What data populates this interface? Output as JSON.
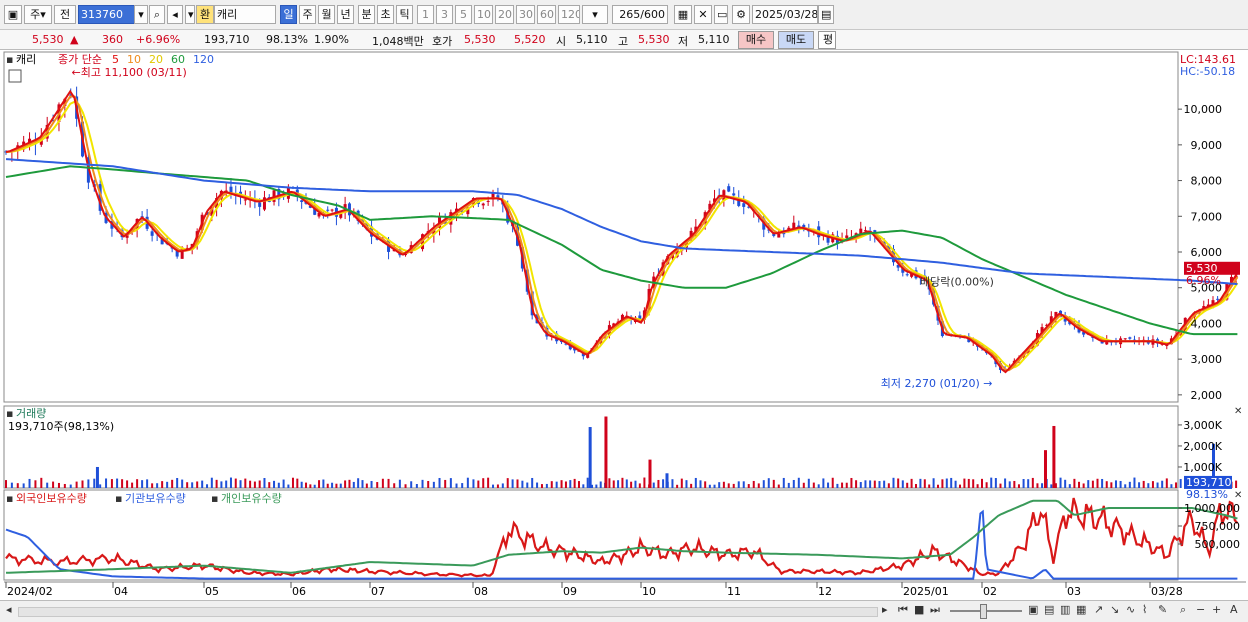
{
  "toolbar": {
    "mode": "주",
    "market": "전",
    "code": "313760",
    "stock_badge": "환",
    "stock_name": "캐리",
    "periods": [
      "일",
      "주",
      "월",
      "년",
      "분",
      "초",
      "틱"
    ],
    "intervals": [
      "1",
      "3",
      "5",
      "10",
      "20",
      "30",
      "60",
      "120"
    ],
    "count": "265",
    "count_max": "/600",
    "date": "2025/03/28"
  },
  "quote": {
    "price": "5,530",
    "change": "360",
    "change_pct": "+6.96%",
    "volume": "193,710",
    "vol_ratio": "98.13%",
    "turnover": "1.90%",
    "amount": "1,048백만",
    "ask_label": "호가",
    "ask1": "5,530",
    "ask2": "5,520",
    "open_label": "시",
    "open": "5,110",
    "high_label": "고",
    "high": "5,530",
    "low_label": "저",
    "low": "5,110",
    "buy": "매수",
    "sell": "매도",
    "eval": "평"
  },
  "panels": {
    "price_title": "캐리",
    "ma_title": "종가 단순",
    "vol_title": "거래량",
    "vol_info": "193,710주(98,13%)",
    "lc": "LC:143.61",
    "hc": "HC:-50.18"
  },
  "colors": {
    "up": "#d0021b",
    "down": "#1e4fd8",
    "ma5": "#e01010",
    "ma10": "#f08c1e",
    "ma20": "#f2e600",
    "ma60": "#1e9a3c",
    "ma120": "#2f5fe0",
    "foreign": "#d81818",
    "institution": "#2f5fe0",
    "individual": "#3a9a5a"
  },
  "chart_data": [
    {
      "type": "candlestick",
      "title": "캐리",
      "ylim": [
        1800,
        11600
      ],
      "y_ticks": [
        "10,000",
        "9,000",
        "8,000",
        "7,000",
        "6,000",
        "5,000",
        "4,000",
        "3,000",
        "2,000"
      ],
      "x_ticks": [
        "2024/02",
        "04",
        "05",
        "06",
        "07",
        "08",
        "09",
        "10",
        "11",
        "12",
        "2025/01",
        "02",
        "03",
        "03/28"
      ],
      "close_points": [
        {
          "m": 0,
          "v": 8800
        },
        {
          "m": 0.3,
          "v": 9200
        },
        {
          "m": 0.6,
          "v": 10600
        },
        {
          "m": 0.75,
          "v": 8300
        },
        {
          "m": 0.9,
          "v": 7000
        },
        {
          "m": 1.1,
          "v": 6400
        },
        {
          "m": 1.3,
          "v": 7000
        },
        {
          "m": 1.5,
          "v": 6400
        },
        {
          "m": 1.7,
          "v": 6000
        },
        {
          "m": 1.85,
          "v": 6100
        },
        {
          "m": 2.0,
          "v": 7100
        },
        {
          "m": 2.2,
          "v": 7700
        },
        {
          "m": 2.6,
          "v": 7400
        },
        {
          "m": 3.0,
          "v": 7700
        },
        {
          "m": 3.4,
          "v": 7000
        },
        {
          "m": 3.7,
          "v": 7200
        },
        {
          "m": 4.0,
          "v": 6500
        },
        {
          "m": 4.3,
          "v": 5900
        },
        {
          "m": 4.6,
          "v": 6700
        },
        {
          "m": 5.0,
          "v": 7500
        },
        {
          "m": 5.3,
          "v": 7500
        },
        {
          "m": 5.5,
          "v": 6300
        },
        {
          "m": 5.65,
          "v": 4300
        },
        {
          "m": 5.8,
          "v": 3700
        },
        {
          "m": 6.0,
          "v": 3500
        },
        {
          "m": 6.3,
          "v": 3100
        },
        {
          "m": 6.5,
          "v": 3700
        },
        {
          "m": 6.8,
          "v": 4200
        },
        {
          "m": 7.0,
          "v": 4000
        },
        {
          "m": 7.1,
          "v": 5000
        },
        {
          "m": 7.3,
          "v": 5900
        },
        {
          "m": 7.6,
          "v": 6500
        },
        {
          "m": 7.9,
          "v": 7600
        },
        {
          "m": 8.2,
          "v": 7400
        },
        {
          "m": 8.5,
          "v": 6500
        },
        {
          "m": 8.8,
          "v": 6700
        },
        {
          "m": 9.0,
          "v": 6500
        },
        {
          "m": 9.3,
          "v": 6300
        },
        {
          "m": 9.6,
          "v": 6600
        },
        {
          "m": 10.0,
          "v": 5500
        },
        {
          "m": 10.3,
          "v": 5200
        },
        {
          "m": 10.5,
          "v": 3700
        },
        {
          "m": 10.8,
          "v": 3600
        },
        {
          "m": 11.1,
          "v": 3100
        },
        {
          "m": 11.25,
          "v": 2600
        },
        {
          "m": 11.4,
          "v": 3000
        },
        {
          "m": 11.6,
          "v": 3500
        },
        {
          "m": 11.9,
          "v": 4300
        },
        {
          "m": 12.1,
          "v": 3900
        },
        {
          "m": 12.4,
          "v": 3500
        },
        {
          "m": 12.7,
          "v": 3500
        },
        {
          "m": 13.0,
          "v": 3500
        },
        {
          "m": 13.2,
          "v": 3400
        },
        {
          "m": 13.5,
          "v": 4300
        },
        {
          "m": 13.8,
          "v": 4600
        },
        {
          "m": 14.05,
          "v": 5530
        }
      ],
      "ma_legend": [
        {
          "name": "5",
          "color": "#e01010"
        },
        {
          "name": "10",
          "color": "#f08c1e"
        },
        {
          "name": "20",
          "color": "#e0c800"
        },
        {
          "name": "60",
          "color": "#1e9a3c"
        },
        {
          "name": "120",
          "color": "#2f5fe0"
        }
      ],
      "ma60_points": [
        {
          "m": 0,
          "v": 8100
        },
        {
          "m": 0.6,
          "v": 8400
        },
        {
          "m": 1.5,
          "v": 8200
        },
        {
          "m": 2.5,
          "v": 8000
        },
        {
          "m": 3.0,
          "v": 7600
        },
        {
          "m": 3.6,
          "v": 7300
        },
        {
          "m": 4.0,
          "v": 6900
        },
        {
          "m": 4.6,
          "v": 7000
        },
        {
          "m": 5.4,
          "v": 6900
        },
        {
          "m": 6.0,
          "v": 6200
        },
        {
          "m": 6.5,
          "v": 5500
        },
        {
          "m": 7.0,
          "v": 5200
        },
        {
          "m": 7.5,
          "v": 5000
        },
        {
          "m": 8.0,
          "v": 5000
        },
        {
          "m": 8.5,
          "v": 5400
        },
        {
          "m": 9.0,
          "v": 6000
        },
        {
          "m": 9.5,
          "v": 6500
        },
        {
          "m": 10.0,
          "v": 6600
        },
        {
          "m": 10.5,
          "v": 6400
        },
        {
          "m": 11.0,
          "v": 5800
        },
        {
          "m": 11.6,
          "v": 5200
        },
        {
          "m": 12.0,
          "v": 4800
        },
        {
          "m": 12.5,
          "v": 4400
        },
        {
          "m": 13.0,
          "v": 4000
        },
        {
          "m": 13.5,
          "v": 3700
        },
        {
          "m": 14.05,
          "v": 3700
        }
      ],
      "ma120_points": [
        {
          "m": 0,
          "v": 8600
        },
        {
          "m": 1.0,
          "v": 8400
        },
        {
          "m": 2.0,
          "v": 8000
        },
        {
          "m": 3.0,
          "v": 7800
        },
        {
          "m": 4.0,
          "v": 7700
        },
        {
          "m": 5.0,
          "v": 7700
        },
        {
          "m": 5.5,
          "v": 7600
        },
        {
          "m": 6.0,
          "v": 7200
        },
        {
          "m": 6.5,
          "v": 6700
        },
        {
          "m": 7.0,
          "v": 6300
        },
        {
          "m": 7.5,
          "v": 6100
        },
        {
          "m": 8.5,
          "v": 6000
        },
        {
          "m": 9.5,
          "v": 5900
        },
        {
          "m": 10.5,
          "v": 5700
        },
        {
          "m": 11.5,
          "v": 5400
        },
        {
          "m": 12.5,
          "v": 5300
        },
        {
          "m": 13.5,
          "v": 5200
        },
        {
          "m": 14.05,
          "v": 5100
        }
      ],
      "annotations": [
        {
          "text": "최고 11,100 (03/11)",
          "m": 0.65,
          "v": 11100
        },
        {
          "text": "최저 2,270 (01/20)",
          "m": 11.2,
          "v": 2270
        },
        {
          "text": "배당락(0.00%)",
          "m": 10.4,
          "v": 5000
        }
      ],
      "last_price": {
        "label": "5,530",
        "pct": "6.96%",
        "v": 5530
      }
    },
    {
      "type": "bar",
      "title": "거래량",
      "ylim": [
        0,
        3900000
      ],
      "y_ticks": [
        "3,000K",
        "2,000K",
        "1,000K"
      ],
      "y_tick_values": [
        3000000,
        2000000,
        1000000
      ],
      "spikes": [
        {
          "m": 0.85,
          "v": 1000000,
          "dir": "down"
        },
        {
          "m": 6.35,
          "v": 2900000,
          "dir": "down"
        },
        {
          "m": 6.55,
          "v": 3400000,
          "dir": "up"
        },
        {
          "m": 7.1,
          "v": 1350000,
          "dir": "up"
        },
        {
          "m": 7.3,
          "v": 700000,
          "dir": "down"
        },
        {
          "m": 11.85,
          "v": 2950000,
          "dir": "up"
        },
        {
          "m": 11.75,
          "v": 1800000,
          "dir": "up"
        },
        {
          "m": 13.75,
          "v": 2100000,
          "dir": "down"
        }
      ],
      "last": {
        "label": "193,710",
        "pct": "98.13%",
        "v": 193710
      }
    },
    {
      "type": "line",
      "ylim": [
        0,
        1250000
      ],
      "y_ticks": [
        "1,000,000",
        "750,000",
        "500,000"
      ],
      "y_tick_values": [
        1000000,
        750000,
        500000
      ],
      "series": [
        {
          "name": "외국인보유수량",
          "color": "#d81818",
          "points": [
            {
              "m": 0,
              "v": 300000
            },
            {
              "m": 0.5,
              "v": 250000
            },
            {
              "m": 1.0,
              "v": 300000
            },
            {
              "m": 1.5,
              "v": 150000
            },
            {
              "m": 2.0,
              "v": 200000
            },
            {
              "m": 2.5,
              "v": 100000
            },
            {
              "m": 3.0,
              "v": 80000
            },
            {
              "m": 3.5,
              "v": 150000
            },
            {
              "m": 4.0,
              "v": 120000
            },
            {
              "m": 4.6,
              "v": 80000
            },
            {
              "m": 5.2,
              "v": 60000
            },
            {
              "m": 5.4,
              "v": 700000
            },
            {
              "m": 5.8,
              "v": 450000
            },
            {
              "m": 6.2,
              "v": 350000
            },
            {
              "m": 6.5,
              "v": 250000
            },
            {
              "m": 6.8,
              "v": 350000
            },
            {
              "m": 7.0,
              "v": 450000
            },
            {
              "m": 7.3,
              "v": 350000
            },
            {
              "m": 7.6,
              "v": 450000
            },
            {
              "m": 8.0,
              "v": 350000
            },
            {
              "m": 8.3,
              "v": 400000
            },
            {
              "m": 8.6,
              "v": 120000
            },
            {
              "m": 9.0,
              "v": 120000
            },
            {
              "m": 9.5,
              "v": 100000
            },
            {
              "m": 10.0,
              "v": 200000
            },
            {
              "m": 10.4,
              "v": 400000
            },
            {
              "m": 10.7,
              "v": 250000
            },
            {
              "m": 11.0,
              "v": 80000
            },
            {
              "m": 11.2,
              "v": 90000
            },
            {
              "m": 11.5,
              "v": 500000
            },
            {
              "m": 11.7,
              "v": 1000000
            },
            {
              "m": 11.85,
              "v": 300000
            },
            {
              "m": 12.0,
              "v": 950000
            },
            {
              "m": 12.4,
              "v": 850000
            },
            {
              "m": 12.8,
              "v": 600000
            },
            {
              "m": 13.2,
              "v": 350000
            },
            {
              "m": 13.5,
              "v": 850000
            },
            {
              "m": 13.7,
              "v": 400000
            },
            {
              "m": 13.85,
              "v": 1000000
            },
            {
              "m": 14.05,
              "v": 850000
            }
          ]
        },
        {
          "name": "기관보유수량",
          "color": "#2f5fe0",
          "points": [
            {
              "m": 0,
              "v": 700000
            },
            {
              "m": 0.2,
              "v": 600000
            },
            {
              "m": 0.5,
              "v": 150000
            },
            {
              "m": 1.0,
              "v": 50000
            },
            {
              "m": 2.0,
              "v": 20000
            },
            {
              "m": 4.0,
              "v": 20000
            },
            {
              "m": 6.0,
              "v": 20000
            },
            {
              "m": 9.0,
              "v": 20000
            },
            {
              "m": 10.9,
              "v": 20000
            },
            {
              "m": 11.0,
              "v": 1150000
            },
            {
              "m": 11.05,
              "v": 150000
            },
            {
              "m": 11.6,
              "v": 20000
            },
            {
              "m": 11.75,
              "v": 150000
            },
            {
              "m": 11.85,
              "v": 20000
            },
            {
              "m": 14.05,
              "v": 20000
            }
          ]
        },
        {
          "name": "개인보유수량",
          "color": "#3a9a5a",
          "points": [
            {
              "m": 0,
              "v": 100000
            },
            {
              "m": 1.0,
              "v": 150000
            },
            {
              "m": 2.0,
              "v": 200000
            },
            {
              "m": 3.0,
              "v": 100000
            },
            {
              "m": 4.0,
              "v": 250000
            },
            {
              "m": 5.0,
              "v": 200000
            },
            {
              "m": 5.4,
              "v": 350000
            },
            {
              "m": 6.0,
              "v": 400000
            },
            {
              "m": 6.5,
              "v": 380000
            },
            {
              "m": 7.0,
              "v": 450000
            },
            {
              "m": 7.5,
              "v": 400000
            },
            {
              "m": 8.0,
              "v": 380000
            },
            {
              "m": 9.0,
              "v": 350000
            },
            {
              "m": 10.0,
              "v": 300000
            },
            {
              "m": 10.6,
              "v": 350000
            },
            {
              "m": 10.9,
              "v": 600000
            },
            {
              "m": 11.2,
              "v": 900000
            },
            {
              "m": 11.6,
              "v": 1100000
            },
            {
              "m": 11.9,
              "v": 1100000
            },
            {
              "m": 12.1,
              "v": 900000
            },
            {
              "m": 12.5,
              "v": 1000000
            },
            {
              "m": 13.0,
              "v": 1000000
            },
            {
              "m": 13.5,
              "v": 1000000
            },
            {
              "m": 13.9,
              "v": 900000
            },
            {
              "m": 14.05,
              "v": 850000
            }
          ]
        }
      ]
    }
  ]
}
